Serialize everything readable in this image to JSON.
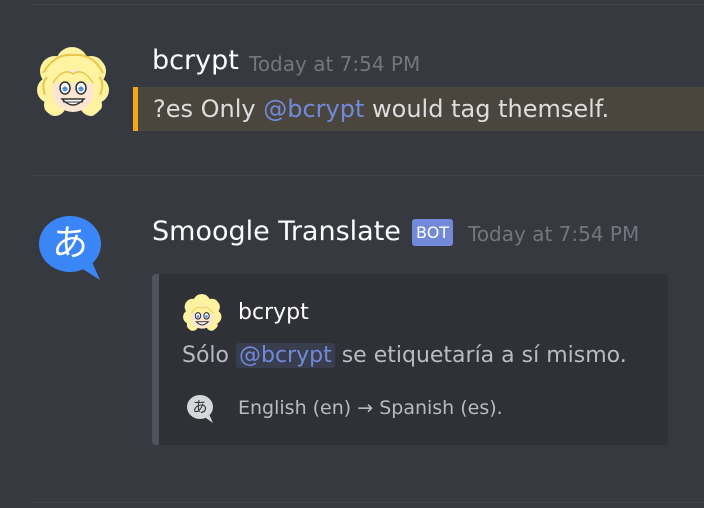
{
  "messages": [
    {
      "author": "bcrypt",
      "timestamp": "Today at 7:54 PM",
      "content_prefix": "?es Only ",
      "content_mention": "@bcrypt",
      "content_suffix": " would tag themself."
    },
    {
      "author": "Smoogle Translate",
      "bot_tag": "BOT",
      "timestamp": "Today at 7:54 PM",
      "avatar_glyph": "あ",
      "embed": {
        "author": "bcrypt",
        "desc_prefix": "Sólo ",
        "desc_mention": "@bcrypt",
        "desc_suffix": " se etiquetaría a sí mismo.",
        "footer_icon_glyph": "あ",
        "footer": "English (en) → Spanish (es)."
      }
    }
  ],
  "colors": {
    "background": "#36393f",
    "mention": "#7289da",
    "highlight_bar": "#faa61a",
    "bot_tag": "#7289da",
    "embed_background": "#2f3136",
    "translate_avatar": "#3b86f7"
  }
}
